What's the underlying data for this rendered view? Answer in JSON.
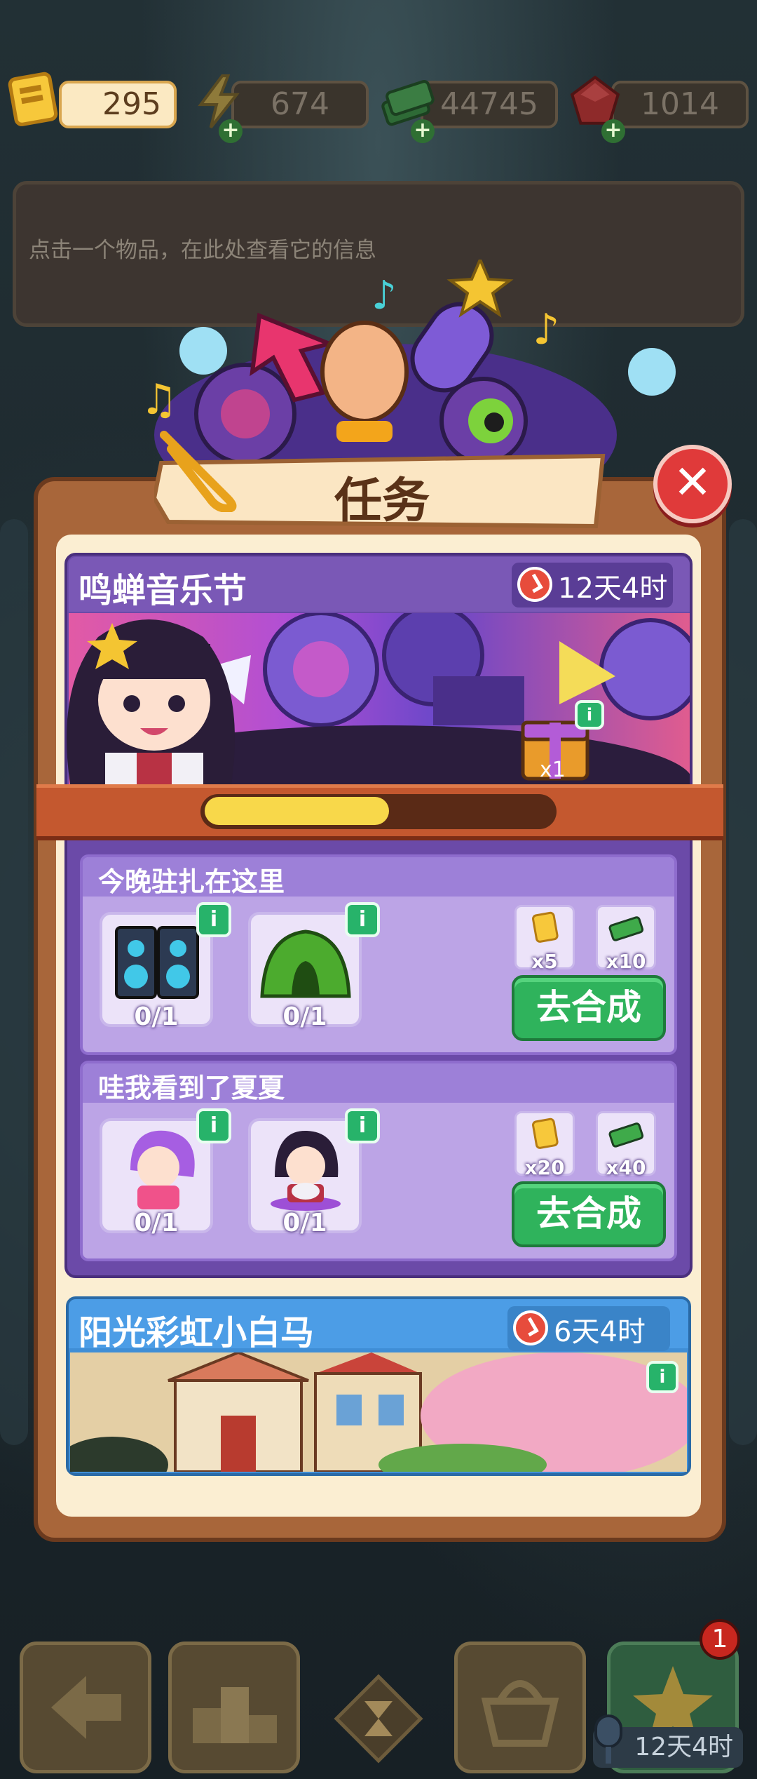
{
  "resources": [
    {
      "name": "ticket",
      "value": "295"
    },
    {
      "name": "energy",
      "value": "674"
    },
    {
      "name": "cash",
      "value": "44745"
    },
    {
      "name": "gem",
      "value": "1014"
    }
  ],
  "info_panel": {
    "hint": "点击一个物品，在此处查看它的信息"
  },
  "dialog": {
    "title": "任务"
  },
  "events": [
    {
      "title": "鸣蝉音乐节",
      "timer": "12天4时",
      "progress": 0.53,
      "reward_count": "x1",
      "tasks": [
        {
          "title": "今晚驻扎在这里",
          "items": [
            {
              "icon": "speakers-icon",
              "count": "0/1"
            },
            {
              "icon": "tent-icon",
              "count": "0/1"
            }
          ],
          "rewards": [
            {
              "icon": "ticket-icon",
              "count": "x5"
            },
            {
              "icon": "cash-icon",
              "count": "x10"
            }
          ],
          "button": "去合成"
        },
        {
          "title": "哇我看到了夏夏",
          "items": [
            {
              "icon": "pink-girl-icon",
              "count": "0/1"
            },
            {
              "icon": "guitar-girl-icon",
              "count": "0/1"
            }
          ],
          "rewards": [
            {
              "icon": "ticket-icon",
              "count": "x20"
            },
            {
              "icon": "cash-icon",
              "count": "x40"
            }
          ],
          "button": "去合成"
        }
      ]
    },
    {
      "title": "阳光彩虹小白马",
      "timer": "6天4时"
    }
  ],
  "bottom_bar": {
    "badge": "1",
    "timer": "12天4时"
  },
  "colors": {
    "panel_brown": "#a8663a",
    "event_purple": "#6b4aa8",
    "task_lavender": "#bca4e6",
    "go_button_green": "#2fb35c",
    "progress_yellow": "#f8d84a",
    "close_red": "#e03a3a"
  }
}
